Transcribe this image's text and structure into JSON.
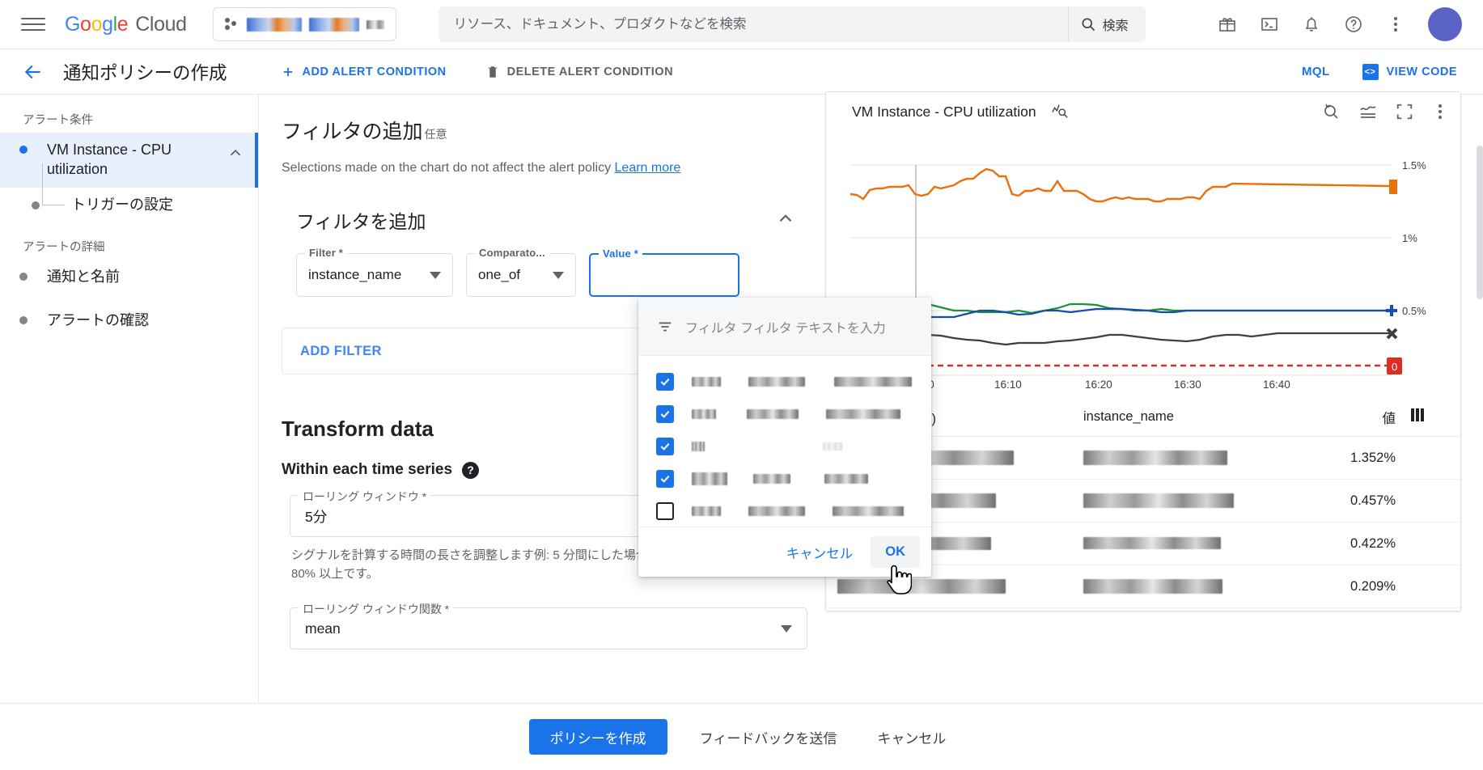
{
  "topbar": {
    "logo": {
      "g1": "G",
      "o1": "o",
      "o2": "o",
      "g2": "g",
      "l1": "l",
      "e1": "e",
      "cloud": "Cloud"
    },
    "search_placeholder": "リソース、ドキュメント、プロダクトなどを検索",
    "search_button": "検索",
    "icons": [
      "gift-icon",
      "terminal-icon",
      "bell-icon",
      "help-icon",
      "kebab-menu-icon",
      "avatar"
    ]
  },
  "pagehead": {
    "title": "通知ポリシーの作成",
    "add_alert_condition": "ADD ALERT CONDITION",
    "delete_alert_condition": "DELETE ALERT CONDITION",
    "mql": "MQL",
    "view_code": "VIEW CODE"
  },
  "leftnav": {
    "group1_label": "アラート条件",
    "item1": "VM Instance - CPU utilization",
    "item1_sub": "トリガーの設定",
    "group2_label": "アラートの詳細",
    "item2": "通知と名前",
    "item3": "アラートの確認"
  },
  "main": {
    "section_title": "フィルタの追加",
    "section_optional": "任意",
    "section_sub": "Selections made on the chart do not affect the alert policy",
    "learn_more": "Learn more",
    "card_title": "フィルタを追加",
    "filter_label": "Filter *",
    "filter_value": "instance_name",
    "comparator_label": "Comparato...",
    "comparator_value": "one_of",
    "value_label": "Value *",
    "add_filter": "ADD FILTER",
    "transform_title": "Transform data",
    "within_each": "Within each time series",
    "rolling_window_label": "ローリング ウィンドウ *",
    "rolling_window_value": "5分",
    "rolling_window_help": "シグナルを計算する時間の長さを調整します例: 5 分間にした場合の CPU 使用率の平均は 80% 以上です。",
    "rolling_window_fn_label": "ローリング ウィンドウ関数 *",
    "rolling_window_fn_value": "mean"
  },
  "dropdown": {
    "filter_placeholder": "フィルタ フィルタ テキストを入力",
    "cancel": "キャンセル",
    "ok": "OK",
    "items": [
      {
        "checked": true,
        "redacted": true
      },
      {
        "checked": true,
        "redacted": true
      },
      {
        "checked": true,
        "redacted": true
      },
      {
        "checked": true,
        "redacted": true
      },
      {
        "checked": false,
        "redacted": true
      }
    ]
  },
  "chart_data": {
    "type": "line",
    "title": "VM Instance - CPU utilization",
    "xlabel": "",
    "ylabel": "",
    "ylim": [
      0,
      1.6
    ],
    "yticks": [
      "1.5%",
      "1%",
      "0.5%"
    ],
    "ytick_values": [
      1.5,
      1.0,
      0.5
    ],
    "xticks": [
      "16:00",
      "16:10",
      "16:20",
      "16:30",
      "16:40"
    ],
    "grid": true,
    "legend": "none",
    "threshold": {
      "value": 0,
      "label": "0",
      "color": "#d93025",
      "style": "dashed"
    },
    "series": [
      {
        "name": "series-orange",
        "color": "#e8710a",
        "marker": "square",
        "values": [
          1.3,
          1.29,
          1.27,
          1.31,
          1.32,
          1.32,
          1.33,
          1.33,
          1.33,
          1.34,
          1.3,
          1.29,
          1.3,
          1.33,
          1.32,
          1.33,
          1.34,
          1.36,
          1.37,
          1.37,
          1.4,
          1.42,
          1.41,
          1.38,
          1.38,
          1.3,
          1.29,
          1.31,
          1.31,
          1.32,
          1.31,
          1.31,
          1.36,
          1.31,
          1.31,
          1.31,
          1.3,
          1.27,
          1.26,
          1.26,
          1.27,
          1.28,
          1.27,
          1.28,
          1.27,
          1.27,
          1.27,
          1.26,
          1.26,
          1.27,
          1.27,
          1.27,
          1.28,
          1.28,
          1.27,
          1.31,
          1.33,
          1.33,
          1.33,
          1.35
        ]
      },
      {
        "name": "series-green",
        "color": "#1e8e3e",
        "marker": "plus",
        "values": [
          0.5,
          0.5,
          0.5,
          0.5,
          0.5,
          0.5,
          0.51,
          0.51,
          0.52,
          0.53,
          0.52,
          0.54,
          0.52,
          0.53,
          0.52,
          0.5,
          0.5,
          0.5,
          0.5,
          0.49,
          0.49,
          0.49,
          0.49,
          0.49,
          0.5,
          0.49,
          0.48,
          0.49,
          0.49,
          0.51,
          0.52,
          0.52,
          0.52,
          0.51,
          0.51,
          0.5,
          0.5,
          0.5,
          0.51,
          0.5,
          0.5,
          0.49,
          0.5,
          0.5,
          0.51,
          0.5,
          0.5,
          0.5,
          0.5,
          0.5,
          0.5,
          0.5,
          0.5,
          0.5,
          0.5,
          0.5,
          0.5,
          0.5,
          0.5,
          0.5
        ]
      },
      {
        "name": "series-blue",
        "color": "#174ea6",
        "marker": "plus",
        "values": [
          0.46,
          0.46,
          0.46,
          0.47,
          0.47,
          0.47,
          0.47,
          0.47,
          0.47,
          0.47,
          0.47,
          0.47,
          0.47,
          0.47,
          0.47,
          0.49,
          0.5,
          0.5,
          0.5,
          0.49,
          0.48,
          0.48,
          0.49,
          0.5,
          0.5,
          0.49,
          0.48,
          0.49,
          0.5,
          0.5,
          0.5,
          0.51,
          0.51,
          0.51,
          0.51,
          0.51,
          0.5,
          0.5,
          0.49,
          0.49,
          0.49,
          0.49,
          0.5,
          0.5,
          0.49,
          0.49,
          0.5,
          0.5,
          0.5,
          0.5,
          0.5,
          0.5,
          0.5,
          0.5,
          0.5,
          0.5,
          0.5,
          0.5,
          0.5,
          0.5
        ]
      },
      {
        "name": "series-dark",
        "color": "#3c4043",
        "marker": "x",
        "values": [
          0.42,
          0.42,
          0.42,
          0.42,
          0.42,
          0.42,
          0.43,
          0.43,
          0.44,
          0.44,
          0.44,
          0.44,
          0.43,
          0.43,
          0.42,
          0.43,
          0.42,
          0.42,
          0.42,
          0.41,
          0.41,
          0.41,
          0.41,
          0.41,
          0.41,
          0.41,
          0.42,
          0.42,
          0.42,
          0.42,
          0.42,
          0.42,
          0.42,
          0.42,
          0.42,
          0.42,
          0.43,
          0.43,
          0.43,
          0.43,
          0.44,
          0.44,
          0.43,
          0.43,
          0.43,
          0.43,
          0.43,
          0.43,
          0.42,
          0.42,
          0.42,
          0.42,
          0.42,
          0.42,
          0.43,
          0.43,
          0.43,
          0.44,
          0.43,
          0.43
        ]
      }
    ]
  },
  "table": {
    "headers": [
      "前（instance_id)",
      "instance_name",
      "値"
    ],
    "rows": [
      {
        "instance_id": "",
        "instance_name": "",
        "value": "1.352%"
      },
      {
        "instance_id": "",
        "instance_name": "",
        "value": "0.457%"
      },
      {
        "instance_id": "",
        "instance_name": "",
        "value": "0.422%"
      },
      {
        "instance_id": "",
        "instance_name": "",
        "value": "0.209%"
      }
    ]
  },
  "bottombar": {
    "create_policy": "ポリシーを作成",
    "send_feedback": "フィードバックを送信",
    "cancel": "キャンセル"
  }
}
